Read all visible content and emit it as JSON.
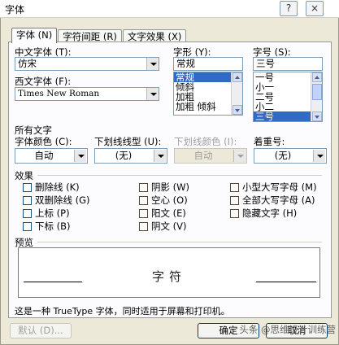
{
  "window": {
    "title": "字体",
    "help_glyph": "?",
    "close_glyph": "×"
  },
  "tabs": [
    {
      "label": "字体 (N)"
    },
    {
      "label": "字符间距 (R)"
    },
    {
      "label": "文字效果 (X)"
    }
  ],
  "font": {
    "chinese_label": "中文字体 (T):",
    "chinese_value": "仿宋",
    "western_label": "西文字体 (F):",
    "western_value": "Times New Roman",
    "style_label": "字形 (Y):",
    "style_value": "常规",
    "style_options": [
      "常规",
      "倾斜",
      "加粗",
      "加粗 倾斜"
    ],
    "style_selected_index": 0,
    "size_label": "字号 (S):",
    "size_value": "三号",
    "size_options": [
      "一号",
      "小一",
      "二号",
      "小二",
      "三号"
    ],
    "size_selected_index": 4
  },
  "all_text": {
    "heading": "所有文字",
    "color_label": "字体颜色 (C):",
    "color_value": "自动",
    "underline_label": "下划线线型 (U):",
    "underline_value": "(无)",
    "underline_color_label": "下划线颜色 (I):",
    "underline_color_value": "自动",
    "emphasis_label": "着重号:",
    "emphasis_value": "(无)"
  },
  "effects": {
    "heading": "效果",
    "col1": [
      "删除线 (K)",
      "双删除线 (G)",
      "上标 (P)",
      "下标 (B)"
    ],
    "col2": [
      "阴影 (W)",
      "空心 (O)",
      "阳文 (E)",
      "阴文 (V)"
    ],
    "col3": [
      "小型大写字母 (M)",
      "全部大写字母 (A)",
      "隐藏文字 (H)"
    ]
  },
  "preview": {
    "heading": "预览",
    "sample": "字符",
    "note": "这是一种 TrueType 字体，同时适用于屏幕和打印机。"
  },
  "buttons": {
    "default": "默认 (D)...",
    "ok": "确定",
    "cancel": "取消"
  },
  "watermark": "头条 @思维设计训练营"
}
